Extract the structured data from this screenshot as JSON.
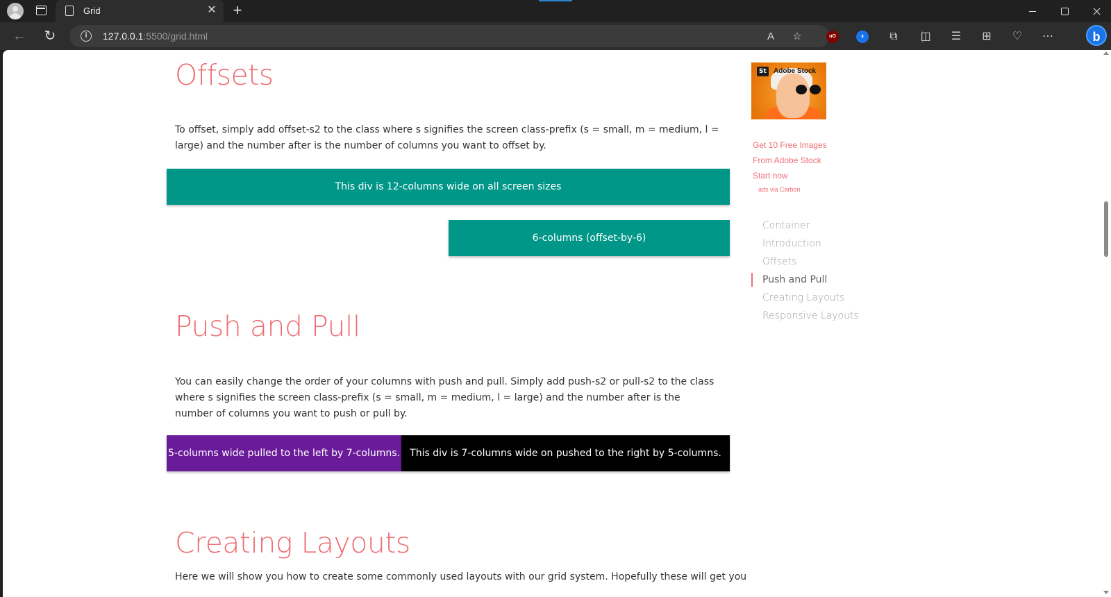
{
  "browser": {
    "tab_title": "Grid",
    "tab_icon": "file-icon",
    "url_host": "127.0.0.1",
    "url_rest": ":5500/grid.html",
    "accent_color": "#2a87d6",
    "extensions": [
      "read-aloud-icon",
      "favorite-star-icon",
      "ublock-origin-icon",
      "audio-extension-icon",
      "extensions-puzzle-icon",
      "split-screen-icon",
      "favorites-icon",
      "collections-icon",
      "performance-heart-icon",
      "more-menu-icon",
      "bing-copilot-icon"
    ],
    "ublock_label": "uO",
    "bing_label": "b"
  },
  "page": {
    "accent_color": "#ee6e73",
    "offsets": {
      "heading": "Offsets",
      "paragraph": "To offset, simply add offset-s2 to the class where s signifies the screen class-prefix (s = small, m = medium, l = large) and the number after is the number of columns you want to offset by.",
      "box_full": "This div is 12-columns wide on all screen sizes",
      "box_offset": "6-columns (offset-by-6)"
    },
    "push_pull": {
      "heading": "Push and Pull",
      "paragraph": "You can easily change the order of your columns with push and pull. Simply add push-s2 or pull-s2 to the class where s signifies the screen class-prefix (s = small, m = medium, l = large) and the number after is the number of columns you want to push or pull by.",
      "box_pull": "5-columns wide pulled to the left by 7-columns.",
      "box_push": "This div is 7-columns wide on pushed to the right by 5-columns."
    },
    "creating_layouts": {
      "heading": "Creating Layouts",
      "paragraph": "Here we will show you how to create some commonly used layouts with our grid system. Hopefully these will get you"
    },
    "ad": {
      "logo": "St",
      "brand": "Adobe Stock",
      "line1": "Get 10 Free Images",
      "line2": "From Adobe Stock",
      "line3": "Start now",
      "via": "ads via Carbon"
    },
    "toc": [
      {
        "label": "Container",
        "active": false
      },
      {
        "label": "Introduction",
        "active": false
      },
      {
        "label": "Offsets",
        "active": false
      },
      {
        "label": "Push and Pull",
        "active": true
      },
      {
        "label": "Creating Layouts",
        "active": false
      },
      {
        "label": "Responsive Layouts",
        "active": false
      }
    ]
  }
}
